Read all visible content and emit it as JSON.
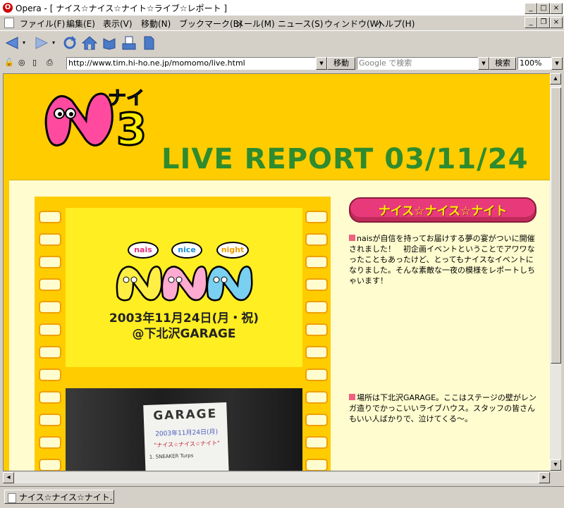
{
  "window": {
    "title": "Opera - [ ナイス☆ナイス☆ナイト☆ライブ☆レポート ]",
    "app_icon": "opera-icon"
  },
  "menu": {
    "items": [
      "ファイル(F)",
      "編集(E)",
      "表示(V)",
      "移動(N)",
      "ブックマーク(B)",
      "メール(M)",
      "ニュース(S)",
      "ウィンドウ(W)",
      "ヘルプ(H)"
    ]
  },
  "address": {
    "url": "http://www.tim.hi-ho.ne.jp/momomo/live.html",
    "go_label": "移動",
    "search_placeholder": "Google で検索",
    "search_button": "検索",
    "zoom": "100%"
  },
  "page": {
    "logo_katakana": "ナイ",
    "logo_number": "3",
    "heading": "LIVE REPORT  03/11/24",
    "poster": {
      "bubbles": [
        "nais",
        "nice",
        "night"
      ],
      "date_line": "2003年11月24日(月・祝)",
      "venue_line": "@下北沢GARAGE"
    },
    "photo_sign": {
      "name": "GARAGE",
      "date": "2003年11月24日(月)",
      "line1": "\"ナイス☆ナイス☆ナイト\"",
      "line2": "1. SNEAKER Turps"
    },
    "banner": "ナイス☆ナイス☆ナイト",
    "paragraphs": [
      "naisが自信を持ってお届けする夢の宴がついに開催されました！　初企画イベントということでアワワなったこともあったけど、とってもナイスなイベントになりました。そんな素敵な一夜の模様をレポートしちゃいます！",
      "場所は下北沢GARAGE。ここはステージの壁がレンガ造りでかっこいいライブハウス。スタッフの皆さんもいい人ばかりで、泣けてくる〜。"
    ]
  },
  "status": {
    "tab_title": "ナイス☆ナイス☆ナイト..."
  },
  "colors": {
    "page_bg": "#ffcc00",
    "content_bg": "#fffccf",
    "heading_green": "#2e8b2e",
    "banner_pink": "#e83a7a",
    "bullet_pink": "#f06080"
  }
}
